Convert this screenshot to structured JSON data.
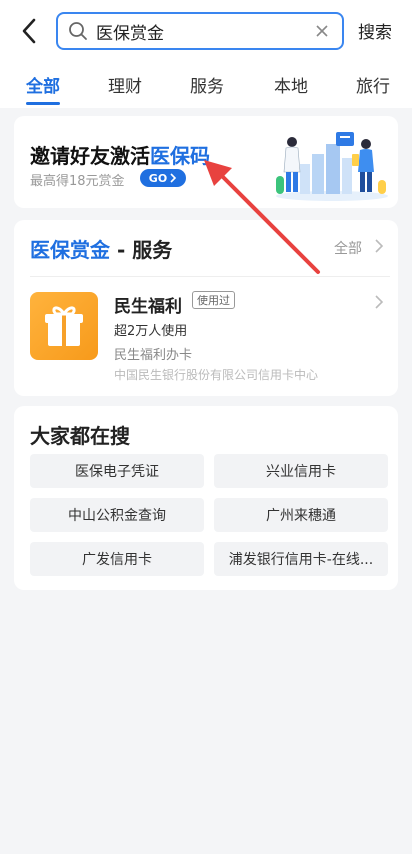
{
  "header": {
    "search_query": "医保赏金",
    "search_button": "搜索"
  },
  "tabs": [
    "全部",
    "理财",
    "服务",
    "本地",
    "旅行"
  ],
  "promo": {
    "title_prefix": "邀请好友激活",
    "title_highlight": "医保码",
    "subtitle": "最高得18元赏金",
    "go_label": "GO"
  },
  "service": {
    "title_highlight": "医保赏金",
    "title_suffix": " - 服务",
    "all_label": "全部",
    "app": {
      "name": "民生福利",
      "badge": "使用过",
      "users": "超2万人使用",
      "desc": "民生福利办卡",
      "company": "中国民生银行股份有限公司信用卡中心"
    }
  },
  "hot": {
    "title": "大家都在搜",
    "items": [
      "医保电子凭证",
      "兴业信用卡",
      "中山公积金查询",
      "广州来穗通",
      "广发信用卡",
      "浦发银行信用卡-在线..."
    ]
  },
  "colors": {
    "accent": "#1f6fe0",
    "annotation_arrow": "#e8423f",
    "app_icon": "#f7a12a"
  }
}
